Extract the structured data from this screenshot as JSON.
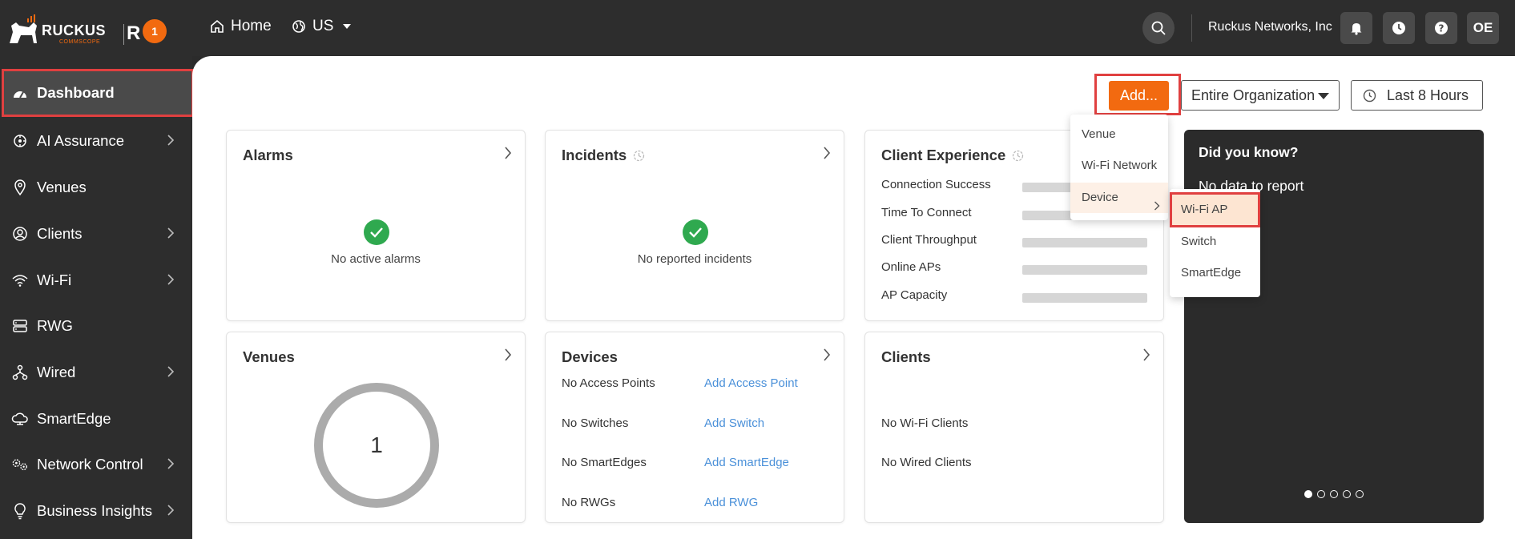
{
  "topbar": {
    "brand": "RUCKUS",
    "brand_sub": "COMMSCOPE",
    "product": "R",
    "product_sup": "1",
    "home_label": "Home",
    "region_label": "US",
    "org_name": "Ruckus Networks, Inc",
    "user_initials": "OE"
  },
  "sidebar": {
    "items": [
      {
        "label": "Dashboard",
        "icon": "dashboard-icon",
        "active": true
      },
      {
        "label": "AI Assurance",
        "icon": "ai-icon",
        "has_children": true
      },
      {
        "label": "Venues",
        "icon": "location-pin-icon"
      },
      {
        "label": "Clients",
        "icon": "user-circle-icon",
        "has_children": true
      },
      {
        "label": "Wi-Fi",
        "icon": "wifi-icon",
        "has_children": true
      },
      {
        "label": "RWG",
        "icon": "server-icon"
      },
      {
        "label": "Wired",
        "icon": "network-icon",
        "has_children": true
      },
      {
        "label": "SmartEdge",
        "icon": "cloud-icon"
      },
      {
        "label": "Network Control",
        "icon": "gears-icon",
        "has_children": true
      },
      {
        "label": "Business Insights",
        "icon": "lightbulb-icon",
        "has_children": true
      }
    ]
  },
  "toolbar": {
    "add_label": "Add...",
    "scope_label": "Entire Organization",
    "time_label": "Last 8 Hours"
  },
  "add_menu": {
    "items": [
      "Venue",
      "Wi-Fi Network",
      "Device"
    ],
    "device_submenu": [
      "Wi-Fi AP",
      "Switch",
      "SmartEdge"
    ]
  },
  "cards": {
    "alarms": {
      "title": "Alarms",
      "message": "No active alarms"
    },
    "incidents": {
      "title": "Incidents",
      "message": "No reported incidents"
    },
    "client_experience": {
      "title": "Client Experience",
      "rows": [
        "Connection Success",
        "Time To Connect",
        "Client Throughput",
        "Online APs",
        "AP Capacity"
      ]
    },
    "venues": {
      "title": "Venues",
      "count": "1"
    },
    "devices": {
      "title": "Devices",
      "rows": [
        {
          "label": "No Access Points",
          "link": "Add Access Point"
        },
        {
          "label": "No Switches",
          "link": "Add Switch"
        },
        {
          "label": "No SmartEdges",
          "link": "Add SmartEdge"
        },
        {
          "label": "No RWGs",
          "link": "Add RWG"
        }
      ]
    },
    "clients": {
      "title": "Clients",
      "rows": [
        "No Wi-Fi Clients",
        "No Wired Clients"
      ]
    },
    "did_you_know": {
      "title": "Did you know?",
      "message": "No data to report",
      "page_count": 5,
      "current_page": 1
    }
  },
  "colors": {
    "accent": "#f26a10",
    "success": "#2fa94f",
    "link": "#4a90d9",
    "highlight_outline": "#e04040"
  }
}
